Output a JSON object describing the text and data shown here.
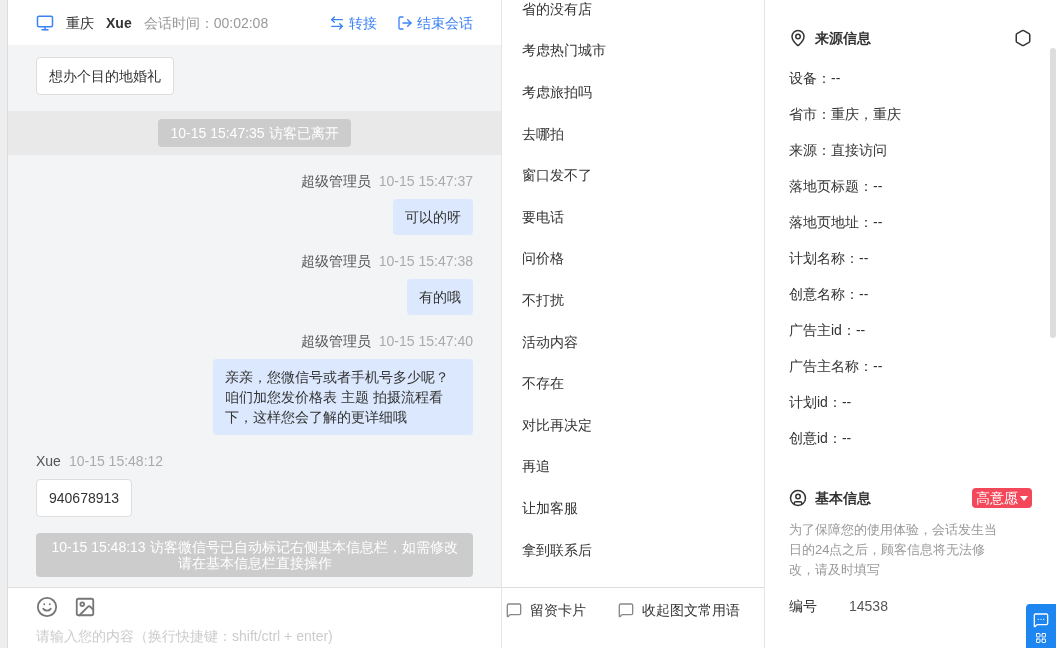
{
  "header": {
    "location": "重庆",
    "visitor": "Xue",
    "duration_label": "会话时间：00:02:08",
    "actions": [
      {
        "kind": "transfer",
        "label": "转接"
      },
      {
        "kind": "end",
        "label": "结束会话"
      }
    ]
  },
  "messages": [
    {
      "kind": "visitor",
      "text": "想办个目的地婚礼"
    },
    {
      "kind": "system",
      "text": "10-15 15:47:35 访客已离开",
      "banded": true
    },
    {
      "kind": "agent",
      "sender": "超级管理员",
      "time": "10-15 15:47:37",
      "text": "可以的呀"
    },
    {
      "kind": "agent",
      "sender": "超级管理员",
      "time": "10-15 15:47:38",
      "text": "有的哦"
    },
    {
      "kind": "agent",
      "sender": "超级管理员",
      "time": "10-15 15:47:40",
      "text": "亲亲，您微信号或者手机号多少呢？咱们加您发价格表 主题 拍摄流程看下，这样您会了解的更详细哦"
    },
    {
      "kind": "visitor",
      "sender": "Xue",
      "time": "10-15 15:48:12",
      "text": "940678913"
    },
    {
      "kind": "system",
      "text": "10-15 15:48:13 访客微信号已自动标记右侧基本信息栏，如需修改请在基本信息栏直接操作",
      "banded": false
    }
  ],
  "composer": {
    "tools": [
      {
        "kind": "card",
        "label": "留资卡片"
      },
      {
        "kind": "phrases",
        "label": "收起图文常用语"
      }
    ],
    "placeholder": "请输入您的内容（换行快捷键：shift/ctrl + enter)"
  },
  "phrases": [
    "省的没有店",
    "考虑热门城市",
    "考虑旅拍吗",
    "去哪拍",
    "窗口发不了",
    "要电话",
    "问价格",
    "不打扰",
    "活动内容",
    "不存在",
    "对比再决定",
    "再追",
    "让加客服",
    "拿到联系后"
  ],
  "source_info": {
    "title": "来源信息",
    "fields": [
      "设备：--",
      "省市：重庆，重庆",
      "来源：直接访问",
      "落地页标题：--",
      "落地页地址：--",
      "计划名称：--",
      "创意名称：--",
      "广告主id：--",
      "广告主名称：--",
      "计划id：--",
      "创意id：--"
    ]
  },
  "basic_info": {
    "title": "基本信息",
    "intent": {
      "label": "高意愿",
      "color": "#f5475a"
    },
    "notice": "为了保障您的使用体验，会话发生当日的24点之后，顾客信息将无法修改，请及时填写",
    "fields": [
      {
        "label": "编号",
        "value": "14538"
      }
    ]
  }
}
